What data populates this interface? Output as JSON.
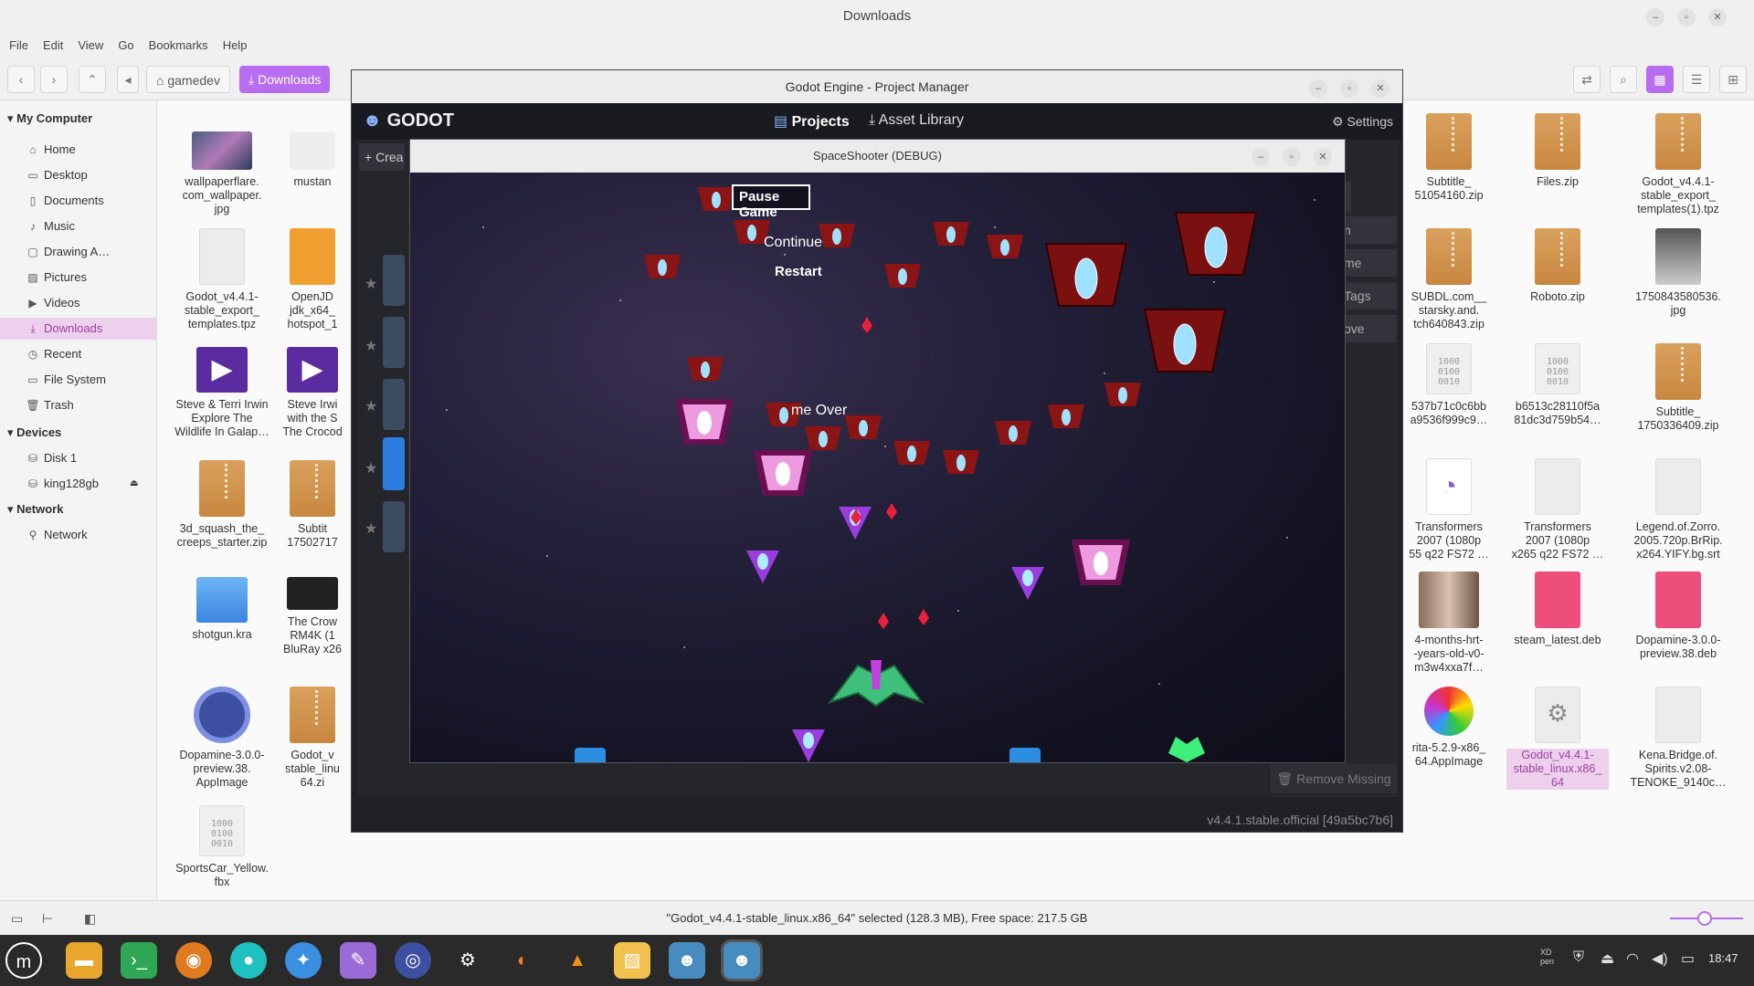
{
  "fm": {
    "title": "Downloads",
    "menu": [
      "File",
      "Edit",
      "View",
      "Go",
      "Bookmarks",
      "Help"
    ],
    "crumbs": [
      "gamedev",
      "Downloads"
    ],
    "sidebar": {
      "my_computer": "My Computer",
      "items": [
        "Home",
        "Desktop",
        "Documents",
        "Music",
        "Drawing A…",
        "Pictures",
        "Videos",
        "Downloads",
        "Recent",
        "File System",
        "Trash"
      ],
      "devices": "Devices",
      "device_items": [
        "Disk 1",
        "king128gb"
      ],
      "network": "Network",
      "network_items": [
        "Network"
      ]
    },
    "files_left": [
      {
        "name": "wallpaperflare.\ncom_wallpaper.\njpg"
      },
      {
        "name": "mustan"
      },
      {
        "name": "Godot_v4.4.1-\nstable_export_\ntemplates.tpz"
      },
      {
        "name": "OpenJD\njdk_x64_\nhotspot_1"
      },
      {
        "name": "Steve & Terri Irwin\nExplore The\nWildlife In Galap…"
      },
      {
        "name": "Steve Irwi\nwith the S\nThe Crocod"
      },
      {
        "name": "3d_squash_the_\ncreeps_starter.zip"
      },
      {
        "name": "Subtit\n17502717"
      },
      {
        "name": "shotgun.kra"
      },
      {
        "name": "The Crow\nRM4K (1\nBluRay x26"
      },
      {
        "name": "Dopamine-3.0.0-\npreview.38.\nAppImage"
      },
      {
        "name": "Godot_v\nstable_linu\n64.zi"
      },
      {
        "name": "SportsCar_Yellow.\nfbx"
      }
    ],
    "files_right": [
      {
        "name": "Subtitle_\n51054160.zip"
      },
      {
        "name": "Files.zip"
      },
      {
        "name": "Godot_v4.4.1-\nstable_export_\ntemplates(1).tpz"
      },
      {
        "name": "SUBDL.com__\nstarsky.and.\ntch640843.zip"
      },
      {
        "name": "Roboto.zip"
      },
      {
        "name": "1750843580536.\njpg"
      },
      {
        "name": "537b71c0c6bb\na9536f999c9…"
      },
      {
        "name": "b6513c28110f5a\n81dc3d759b54…"
      },
      {
        "name": "Subtitle_\n1750336409.zip"
      },
      {
        "name": "Transformers\n2007 (1080p\n55 q22 FS72 …"
      },
      {
        "name": "Transformers\n2007 (1080p\nx265 q22 FS72 …"
      },
      {
        "name": "Legend.of.Zorro.\n2005.720p.BrRip.\nx264.YIFY.bg.srt"
      },
      {
        "name": "4-months-hrt-\n-years-old-v0-\nm3w4xxa7f…"
      },
      {
        "name": "steam_latest.deb"
      },
      {
        "name": "Dopamine-3.0.0-\npreview.38.deb"
      },
      {
        "name": "rita-5.2.9-x86_\n64.AppImage"
      },
      {
        "name": "Godot_v4.4.1-\nstable_linux.x86_\n64"
      },
      {
        "name": "Kena.Bridge.of.\nSpirits.v2.08-\nTENOKE_9140c…"
      }
    ],
    "binary_glyph": "1000\n0100\n0010",
    "status": "\"Godot_v4.4.1-stable_linux.x86_64\" selected (128.3 MB), Free space: 217.5 GB"
  },
  "pm": {
    "title": "Godot Engine - Project Manager",
    "logo": "GODOT",
    "tabs": [
      "Projects",
      "Asset Library"
    ],
    "settings": "Settings",
    "create": "Crea",
    "side_btns": [
      "n",
      "me",
      "Tags",
      "ove"
    ],
    "remove_missing": "Remove Missing",
    "version": "v4.4.1.stable.official [49a5bc7b6]"
  },
  "game": {
    "title": "SpaceShooter (DEBUG)",
    "pause": "Pause Game",
    "continue": "Continue",
    "restart": "Restart",
    "game_over": "me Over"
  },
  "taskbar": {
    "time": "18:47",
    "kb": "XD\npen"
  },
  "colors": {
    "accent": "#a23ea2",
    "downloads_btn": "#b86cf0",
    "godot_bg": "#202127"
  }
}
